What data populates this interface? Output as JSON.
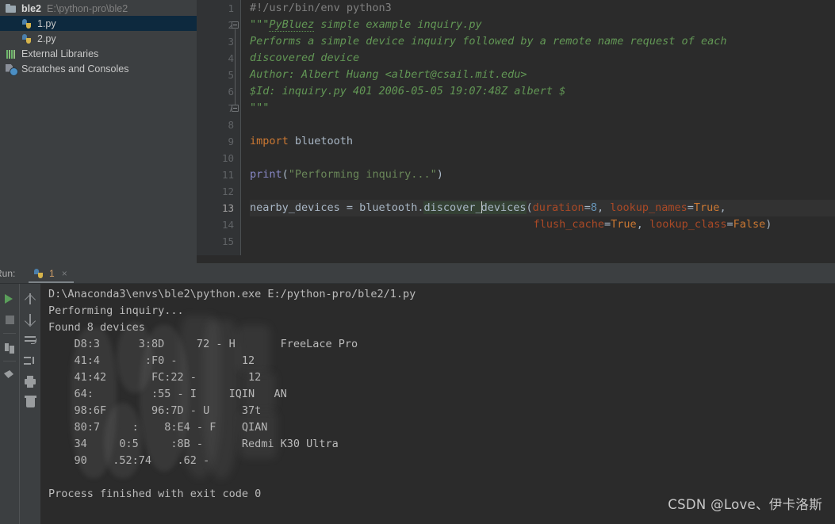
{
  "project_tree": {
    "root": {
      "name": "ble2",
      "path": "E:\\python-pro\\ble2",
      "icon": "folder-icon"
    },
    "items": [
      {
        "label": "1.py",
        "icon": "python-file-icon",
        "selected": true
      },
      {
        "label": "2.py",
        "icon": "python-file-icon",
        "selected": false
      },
      {
        "label": "External Libraries",
        "icon": "libraries-icon",
        "selected": false
      },
      {
        "label": "Scratches and Consoles",
        "icon": "scratches-icon",
        "selected": false
      }
    ]
  },
  "editor": {
    "current_line": 13,
    "selected_identifier": "discover_devices",
    "line_numbers": [
      "1",
      "2",
      "3",
      "4",
      "5",
      "6",
      "7",
      "8",
      "9",
      "10",
      "11",
      "12",
      "13",
      "14",
      "15"
    ],
    "lines": [
      {
        "n": 1,
        "text": "#!/usr/bin/env python3"
      },
      {
        "n": 2,
        "text": "\"\"\"PyBluez simple example inquiry.py"
      },
      {
        "n": 3,
        "text": "Performs a simple device inquiry followed by a remote name request of each"
      },
      {
        "n": 4,
        "text": "discovered device"
      },
      {
        "n": 5,
        "text": "Author: Albert Huang <albert@csail.mit.edu>"
      },
      {
        "n": 6,
        "text": "$Id: inquiry.py 401 2006-05-05 19:07:48Z albert $"
      },
      {
        "n": 7,
        "text": "\"\"\""
      },
      {
        "n": 8,
        "text": ""
      },
      {
        "n": 9,
        "text": "import bluetooth"
      },
      {
        "n": 10,
        "text": ""
      },
      {
        "n": 11,
        "text": "print(\"Performing inquiry...\")"
      },
      {
        "n": 12,
        "text": ""
      },
      {
        "n": 13,
        "text": "nearby_devices = bluetooth.discover_devices(duration=8, lookup_names=True,"
      },
      {
        "n": 14,
        "text": "                                            flush_cache=True, lookup_class=False)"
      },
      {
        "n": 15,
        "text": ""
      }
    ],
    "tokens": {
      "l1_comment": "#!/usr/bin/env python3",
      "l2_docstring_open": "\"\"\"",
      "l2_pybluez": "PyBluez",
      "l2_rest": " simple example inquiry.py",
      "l3": "Performs a simple device inquiry followed by a remote name request of each",
      "l4": "discovered device",
      "l5": "Author: Albert Huang <albert@csail.mit.edu>",
      "l6": "$Id: inquiry.py 401 2006-05-05 19:07:48Z albert $",
      "l7": "\"\"\"",
      "l9_kw": "import",
      "l9_mod": " bluetooth",
      "l11_fn": "print",
      "l11_open": "(",
      "l11_str": "\"Performing inquiry...\"",
      "l11_close": ")",
      "l13_var": "nearby_devices = bluetooth.",
      "l13_sel_a": "discover_",
      "l13_sel_b": "devices",
      "l13_paren": "(",
      "l13_kwarg1": "duration",
      "l13_eq1": "=",
      "l13_num": "8",
      "l13_comma1": ", ",
      "l13_kwarg2": "lookup_names",
      "l13_eq2": "=",
      "l13_true": "True",
      "l13_comma2": ",",
      "l14_indent": "                                            ",
      "l14_kwarg3": "flush_cache",
      "l14_eq3": "=",
      "l14_true": "True",
      "l14_comma3": ", ",
      "l14_kwarg4": "lookup_class",
      "l14_eq4": "=",
      "l14_false": "False",
      "l14_close": ")"
    }
  },
  "run_panel": {
    "label": "Run:",
    "tab": {
      "title": "1",
      "icon": "python-icon",
      "close": "×"
    },
    "toolbar_left": [
      {
        "name": "rerun-button",
        "icon": "run-icon"
      },
      {
        "name": "stop-button",
        "icon": "stop-icon"
      },
      {
        "name": "layout-button",
        "icon": "layout-icon"
      },
      {
        "name": "pin-tab-button",
        "icon": "pin-icon"
      }
    ],
    "toolbar_mid": [
      {
        "name": "up-button",
        "icon": "arrow-up-icon"
      },
      {
        "name": "down-button",
        "icon": "arrow-down-icon"
      },
      {
        "name": "soft-wrap-button",
        "icon": "soft-wrap-icon"
      },
      {
        "name": "scroll-to-end-button",
        "icon": "scroll-to-end-icon"
      },
      {
        "name": "print-button",
        "icon": "print-icon"
      },
      {
        "name": "clear-all-button",
        "icon": "trash-icon"
      }
    ],
    "console_lines": [
      "D:\\Anaconda3\\envs\\ble2\\python.exe E:/python-pro/ble2/1.py",
      "Performing inquiry...",
      "Found 8 devices",
      "    D8:3      3:8D     72 - H       FreeLace Pro",
      "    41:4       :F0 -          12",
      "    41:42       FC:22 -        12",
      "    64:         :55 - I     IQIN   AN",
      "    98:6F       96:7D - U     37t",
      "    80:7     :    8:E4 - F    QIAN",
      "    34     0:5     :8B -      Redmi K30 Ultra",
      "    90    .52:74    .62 -",
      "",
      "Process finished with exit code 0"
    ]
  },
  "watermark": {
    "text": "CSDN @Love、伊卡洛斯"
  }
}
